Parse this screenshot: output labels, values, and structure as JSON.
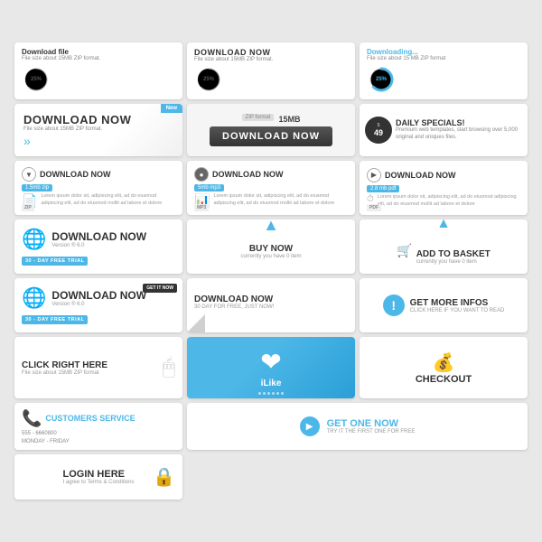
{
  "row1": {
    "card1": {
      "title": "Download file",
      "sub": "File size  about 15MB ZIP format.",
      "pct": "25%",
      "ring_color": "gray"
    },
    "card2": {
      "title": "DOWNLOAD NOW",
      "sub": "File size  about 15MB ZIP format.",
      "pct": "25%",
      "ring_color": "gray"
    },
    "card3": {
      "title": "Downloading...",
      "sub": "File size  about 15 MB ZIP format",
      "pct": "25%",
      "ring_color": "blue"
    }
  },
  "row2": {
    "card1": {
      "title": "DOWNLOAD NOW",
      "sub": "File size about 15MB ZIP format.",
      "ribbon": "New"
    },
    "card2": {
      "zip_label": "ZIP format",
      "zip_size_label": "15MB",
      "btn_label": "DOWNLOAD NOW"
    },
    "card3": {
      "price": "$49",
      "title": "DAILY SPECIALS!",
      "sub": "Premium web templates, start browsing over 5,000 original and uniques files."
    }
  },
  "row3": {
    "card1": {
      "title": "DOWNLOAD NOW",
      "file_tag": "1.5mb zip",
      "body": "Lorem ipsum dolor sit, adipiscing elit, ad do eiusmod adipiscing elit, ad do eiusmod mollit ad labore et dolore",
      "type": "ZIP"
    },
    "card2": {
      "title": "DOWNLOAD NOW",
      "file_tag": "5mb mp3",
      "body": "Lorem ipsum dolor sit, adipiscing elit, ad do eiusmod adipiscing elit, ad do eiusmod mollit ad labore et dolore",
      "type": "MP3"
    },
    "card3": {
      "title": "DOWNLOAD NOW",
      "file_tag": "2.8 mb pdf",
      "body": "Lorem ipsum dolor sit, adipiscing elit, ad do eiusmod adipiscing elit, ad do eiusmod mollit ad labore et dolore",
      "type": "PDF"
    }
  },
  "row4": {
    "card1": {
      "title": "DOWNLOAD NOW",
      "version": "Version ® 6.0",
      "trial": "30 - DAY FREE TRIAL"
    },
    "card2": {
      "arrow_label": "▲",
      "title": "BUY NOW",
      "sub": "currently you have 0 item"
    },
    "card3": {
      "title": "ADD TO BASKET",
      "sub": "currently you have 0 item"
    },
    "card4": {
      "title": "DOWNLOAD NOW",
      "version": "Version ® 6.0",
      "trial": "30 - DAY FREE TRIAL",
      "badge": "GET IT NOW"
    }
  },
  "row5": {
    "card1": {
      "title": "DOWNLOAD NOW",
      "sub": "30 DAY FOR FREE, JUST NOW!"
    },
    "card2": {
      "title": "GET MORE INFOS",
      "sub": "CLICK HERE IF YOU WANT TO READ"
    },
    "card3": {
      "title": "CLICK RIGHT HERE",
      "sub": "File size about 15MB ZIP format"
    }
  },
  "row6": {
    "card1": {
      "title": "iLike"
    },
    "card2": {
      "title": "CHECKOUT"
    },
    "card3": {
      "title": "CUSTOMERS SERVICE",
      "phone": "555 - 6660800",
      "hours": "MONDAY - FRIDAY"
    }
  },
  "row7": {
    "card1": {
      "title": "GET",
      "highlight": "ONE",
      "suffix": "NOW",
      "sub": "TRY IT THE FIRST ONE FOR FREE"
    },
    "card2": {
      "title": "LOGIN HERE",
      "sub": "I agree to Terms & Conditions"
    }
  },
  "colors": {
    "blue": "#4db8e8",
    "dark": "#333",
    "gray": "#888",
    "light_gray": "#f5f5f5"
  }
}
